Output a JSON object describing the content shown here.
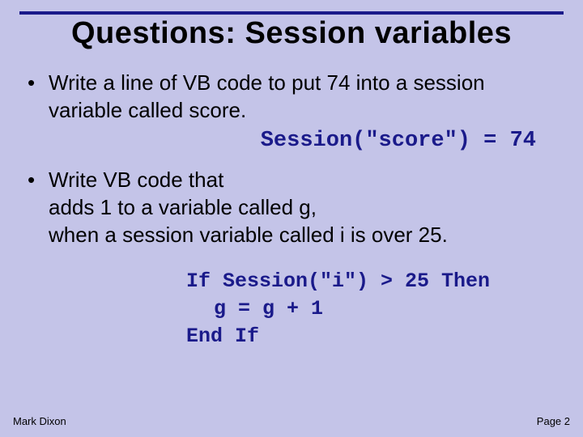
{
  "title": "Questions: Session variables",
  "bullets": [
    "Write a line of VB code to put 74 into a session variable called score.",
    "Write VB code that\nadds 1 to a variable called g,\nwhen a session variable called i is over 25."
  ],
  "code1": "Session(\"score\") = 74",
  "code2": {
    "line1": "If Session(\"i\") > 25 Then",
    "line2": "g = g + 1",
    "line3": "End If"
  },
  "footer": {
    "left": "Mark Dixon",
    "right": "Page 2"
  }
}
